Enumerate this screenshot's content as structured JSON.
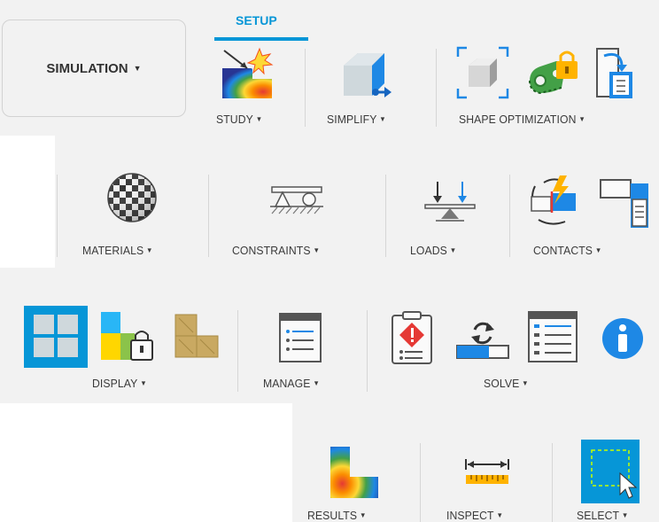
{
  "workspace": {
    "label": "SIMULATION",
    "caret": "▼"
  },
  "tab": {
    "active": "SETUP"
  },
  "row1": {
    "study": "STUDY",
    "simplify": "SIMPLIFY",
    "shape_optimization": "SHAPE OPTIMIZATION"
  },
  "row2": {
    "materials": "MATERIALS",
    "constraints": "CONSTRAINTS",
    "loads": "LOADS",
    "contacts": "CONTACTS"
  },
  "row3": {
    "display": "DISPLAY",
    "manage": "MANAGE",
    "solve": "SOLVE"
  },
  "row4": {
    "results": "RESULTS",
    "inspect": "INSPECT",
    "select": "SELECT"
  },
  "caret": "▼",
  "colors": {
    "accent": "#0696d7",
    "panel_bg": "#f2f2f2",
    "separator": "#d6d6d6"
  },
  "icons": [
    "study-icon",
    "simplify-icon",
    "shape-optimization-box-icon",
    "preserve-region-lock-icon",
    "panel-icon",
    "materials-icon",
    "constraints-icon",
    "loads-icon",
    "contacts-icon",
    "display-mesh-icon",
    "display-lock-icon",
    "display-tiles-icon",
    "manage-list-icon",
    "precheck-icon",
    "solve-sync-icon",
    "solve-details-icon",
    "info-icon",
    "results-icon",
    "inspect-ruler-icon",
    "select-window-icon"
  ]
}
